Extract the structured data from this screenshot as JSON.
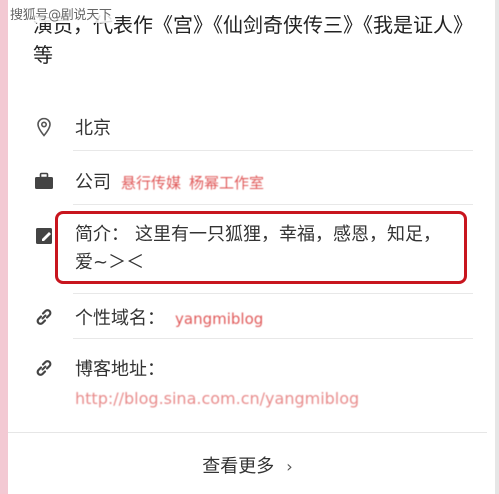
{
  "watermark": "搜狐号@剧说天下",
  "profile": {
    "description": "演员，代表作《宫》《仙剑奇侠传三》《我是证人》等",
    "location": "北京",
    "company_label": "公司",
    "companies": [
      "悬行传媒",
      "杨幂工作室"
    ],
    "bio_label": "简介：",
    "bio_text": "这里有一只狐狸，幸福，感恩，知足，爱~＞＜",
    "domain_label": "个性域名：",
    "domain_value": "yangmiblog",
    "blog_label": "博客地址：",
    "blog_url": "http://blog.sina.com.cn/yangmiblog"
  },
  "more_button": {
    "label": "查看更多",
    "chevron": "›"
  },
  "icons": [
    "location-pin-icon",
    "briefcase-icon",
    "notepad-icon",
    "link-icon"
  ],
  "colors": {
    "highlight_border": "#c8151e",
    "link_red": "#e05a5a",
    "left_edge": "#f3c9d3"
  }
}
